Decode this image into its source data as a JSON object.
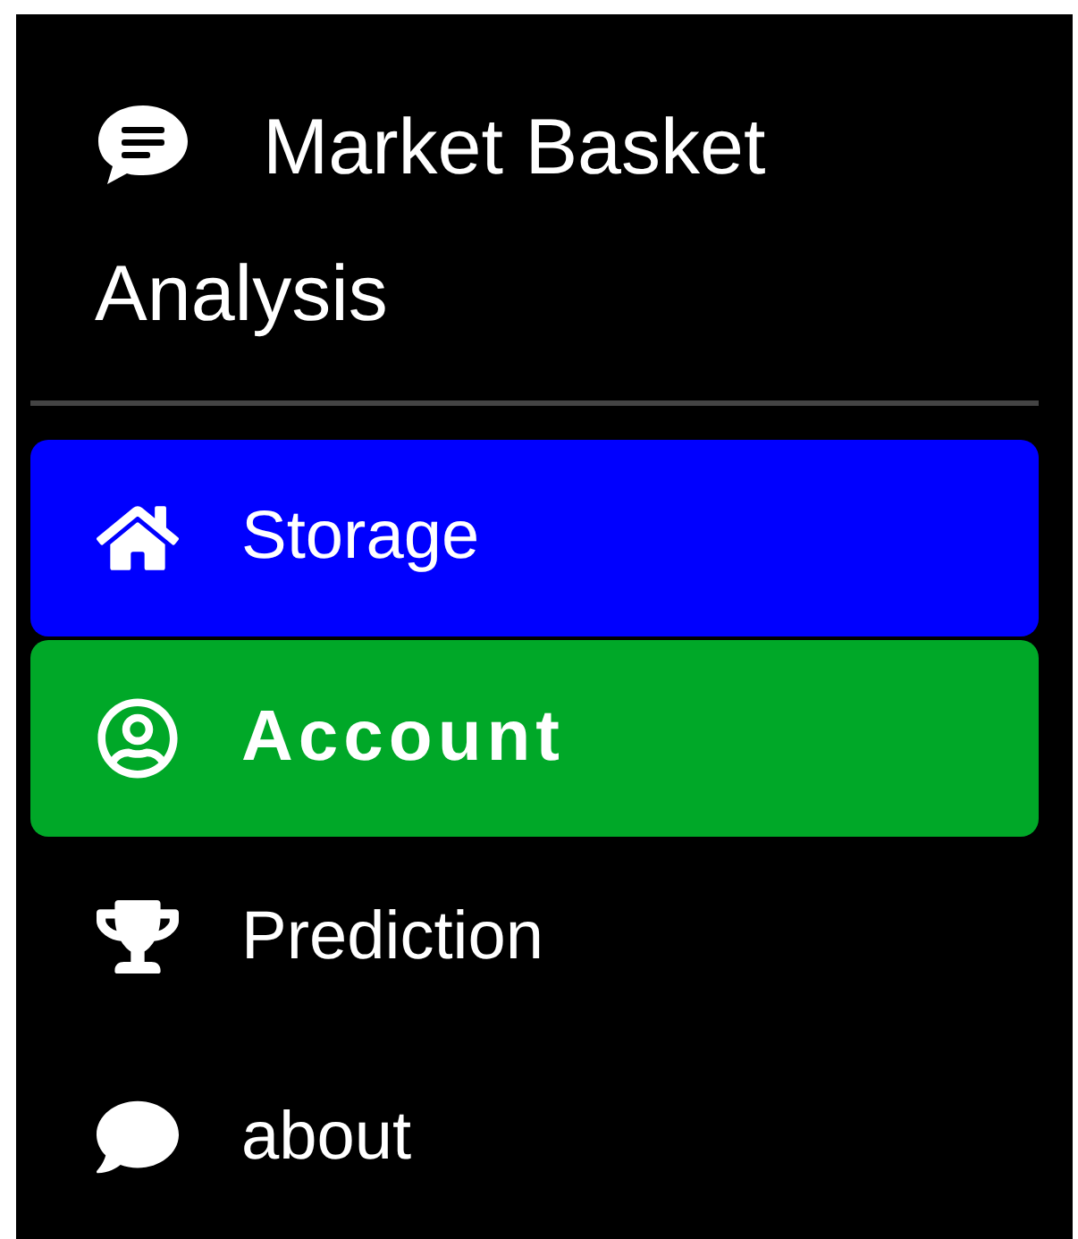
{
  "sidebar": {
    "title": "Market Basket Analysis",
    "items": [
      {
        "label": "Storage",
        "selected": false,
        "color": "#0000ff"
      },
      {
        "label": "Account",
        "selected": true,
        "color": "#00a828"
      },
      {
        "label": "Prediction",
        "selected": false
      },
      {
        "label": "about",
        "selected": false
      }
    ]
  }
}
